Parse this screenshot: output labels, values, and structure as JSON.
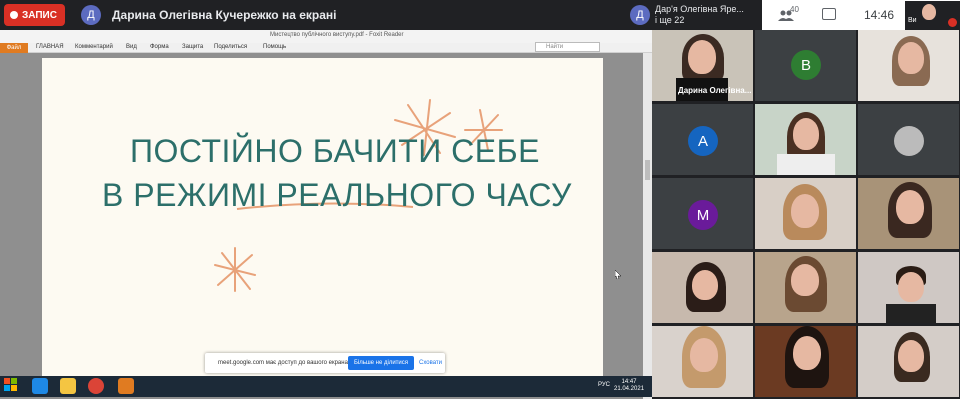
{
  "meet": {
    "record_label": "ЗАПИС",
    "presenter_avatar_letter": "Д",
    "presenter_avatar_color": "#5c6bc0",
    "presenting_title": "Дарина Олегівна Кучережко на екрані",
    "pinned_name_line1": "Дар'я Олегівна Яре...",
    "pinned_name_line2": "і ще 22",
    "pinned_avatar_letter": "Д",
    "participants_count": "40",
    "clock": "14:46",
    "self_label": "Ви"
  },
  "reader": {
    "window_title": "Мистецтво публічного виступу.pdf - Foxit Reader",
    "file_tab": "Файл",
    "menu": [
      "ГЛАВНАЯ",
      "Комментарий",
      "Вид",
      "Форма",
      "Защита",
      "Поделиться",
      "Помощь"
    ],
    "search_value": "Найти",
    "slide_line1": "ПОСТІЙНО БАЧИТИ СЕБЕ",
    "slide_line2": "В РЕЖИМІ РЕАЛЬНОГО ЧАСУ",
    "slide_text_color": "#2c6f6a",
    "accent_color": "#e8a27a"
  },
  "share_notice": {
    "text": "meet.google.com має доступ до вашого екрана.",
    "stop_button": "Більше не ділитися",
    "hide_button": "Сховати"
  },
  "taskbar": {
    "time": "14:47",
    "date": "21.04.2021",
    "lang": "РУС"
  },
  "grid": {
    "tiles": [
      {
        "name": "Дарина Олегівна...",
        "type": "video"
      },
      {
        "letter": "В",
        "color": "#2e7d32",
        "type": "avatar"
      },
      {
        "type": "video"
      },
      {
        "letter": "А",
        "color": "#1565c0",
        "type": "avatar"
      },
      {
        "type": "video"
      },
      {
        "type": "avatar-photo"
      },
      {
        "letter": "М",
        "color": "#6a1b9a",
        "type": "avatar"
      },
      {
        "type": "video"
      },
      {
        "type": "video"
      },
      {
        "type": "video"
      },
      {
        "type": "video"
      },
      {
        "type": "video"
      },
      {
        "type": "video"
      },
      {
        "type": "video"
      },
      {
        "type": "video"
      }
    ]
  }
}
